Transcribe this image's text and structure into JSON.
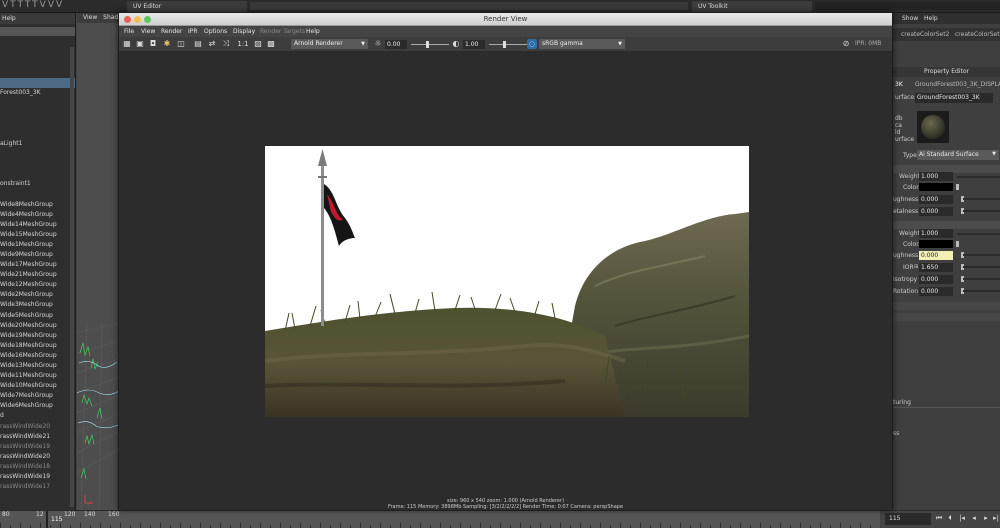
{
  "top": {
    "deco_text": "VTTTTVVV",
    "tab_uv_editor": "UV Editor",
    "tab_uv_toolkit": "UV Toolkit"
  },
  "outliner": {
    "header": "Help",
    "items": [
      {
        "label": "",
        "state": "normal"
      },
      {
        "label": "",
        "state": "normal"
      },
      {
        "label": "",
        "state": "normal"
      },
      {
        "label": "",
        "state": "normal"
      },
      {
        "label": "",
        "state": "sel"
      },
      {
        "label": "Forest003_3K",
        "state": "normal"
      },
      {
        "label": "",
        "state": "normal"
      },
      {
        "label": "",
        "state": "normal"
      },
      {
        "label": "",
        "state": "normal"
      },
      {
        "label": "",
        "state": "normal"
      },
      {
        "label": "aLight1",
        "state": "normal"
      },
      {
        "label": "",
        "state": "normal"
      },
      {
        "label": "",
        "state": "normal"
      },
      {
        "label": "",
        "state": "normal"
      },
      {
        "label": "onstraint1",
        "state": "normal"
      },
      {
        "label": "",
        "state": "normal"
      },
      {
        "label": "Wide8MeshGroup",
        "state": "normal"
      },
      {
        "label": "Wide4MeshGroup",
        "state": "normal"
      },
      {
        "label": "Wide14MeshGroup",
        "state": "normal"
      },
      {
        "label": "Wide15MeshGroup",
        "state": "normal"
      },
      {
        "label": "Wide1MeshGroup",
        "state": "normal"
      },
      {
        "label": "Wide9MeshGroup",
        "state": "normal"
      },
      {
        "label": "Wide17MeshGroup",
        "state": "normal"
      },
      {
        "label": "Wide21MeshGroup",
        "state": "normal"
      },
      {
        "label": "Wide12MeshGroup",
        "state": "normal"
      },
      {
        "label": "Wide2MeshGroup",
        "state": "normal"
      },
      {
        "label": "Wide3MeshGroup",
        "state": "normal"
      },
      {
        "label": "Wide5MeshGroup",
        "state": "normal"
      },
      {
        "label": "Wide20MeshGroup",
        "state": "normal"
      },
      {
        "label": "Wide19MeshGroup",
        "state": "normal"
      },
      {
        "label": "Wide18MeshGroup",
        "state": "normal"
      },
      {
        "label": "Wide16MeshGroup",
        "state": "normal"
      },
      {
        "label": "Wide13MeshGroup",
        "state": "normal"
      },
      {
        "label": "Wide11MeshGroup",
        "state": "normal"
      },
      {
        "label": "Wide10MeshGroup",
        "state": "normal"
      },
      {
        "label": "Wide7MeshGroup",
        "state": "normal"
      },
      {
        "label": "Wide6MeshGroup",
        "state": "normal"
      },
      {
        "label": "d",
        "state": "normal"
      },
      {
        "label": "rassWindWide20",
        "state": "dim"
      },
      {
        "label": "rassWindWide21",
        "state": "normal"
      },
      {
        "label": "rassWindWide19",
        "state": "dim"
      },
      {
        "label": "rassWindWide20",
        "state": "normal"
      },
      {
        "label": "rassWindWide18",
        "state": "dim"
      },
      {
        "label": "rassWindWide19",
        "state": "normal"
      },
      {
        "label": "rassWindWide17",
        "state": "dim"
      }
    ]
  },
  "viewport": {
    "menu_view": "View",
    "menu_shade": "Shad"
  },
  "render_view": {
    "title": "Render View",
    "menus": [
      "File",
      "View",
      "Render",
      "IPR",
      "Options",
      "Display",
      "Render Targets",
      "Help"
    ],
    "disabled_menu": "Render Targets",
    "toolbar": {
      "ratio_label": "1:1",
      "renderer": "Arnold Renderer",
      "exposure_value": "0.00",
      "gamma_value": "1.00",
      "color_space": "sRGB gamma",
      "ipr_label": "IPR: 0MB"
    },
    "status_line1": "size: 960 x 540  zoom: 1.000    (Arnold Renderer)",
    "status_line2": "Frame: 115     Memory: 3898Mb   Sampling: [3/2/2/2/2/2]    Render Time: 0:07    Camera: perspShape"
  },
  "right_panel": {
    "menu_show": "Show",
    "menu_help": "Help",
    "tab1": "createColorSet2",
    "tab2": "createColorSet1",
    "title": "Property Editor",
    "node_prefix": "3K",
    "node_name": "GroundForest003_3K_DISPLACE",
    "surface_label": "urface:",
    "surface_value": "GroundForest003_3K",
    "swatch_labels": [
      "db",
      "ca",
      "ld",
      "urface"
    ],
    "type_label": "Type",
    "type_value": "Ai Standard Surface",
    "diffuse": {
      "weight_label": "Weight",
      "weight_value": "1.000",
      "color_label": "Color",
      "roughness_label": "ughness",
      "roughness_value": "0.000",
      "metalness_label": "etalness",
      "metalness_value": "0.000"
    },
    "specular": {
      "weight_label": "Weight",
      "weight_value": "1.000",
      "color_label": "Color",
      "roughness_label": "ughness",
      "roughness_value": "0.000",
      "ior_label": "IOR",
      "ior_value": "1.650",
      "anisotropy_label": "isotropy",
      "anisotropy_value": "0.000",
      "rotation_label": "Rotation",
      "rotation_value": "0.000"
    },
    "texturing_label": "turing",
    "misc_label": "ss"
  },
  "timeline": {
    "ticks": [
      "80",
      "12",
      "120",
      "140",
      "160"
    ],
    "current_frame": "115",
    "frame_field": "115"
  },
  "colors": {
    "accent_selected": "#4d6a85",
    "field_highlight": "#f2f0b5",
    "color_space_icon": "#2b6da8"
  }
}
